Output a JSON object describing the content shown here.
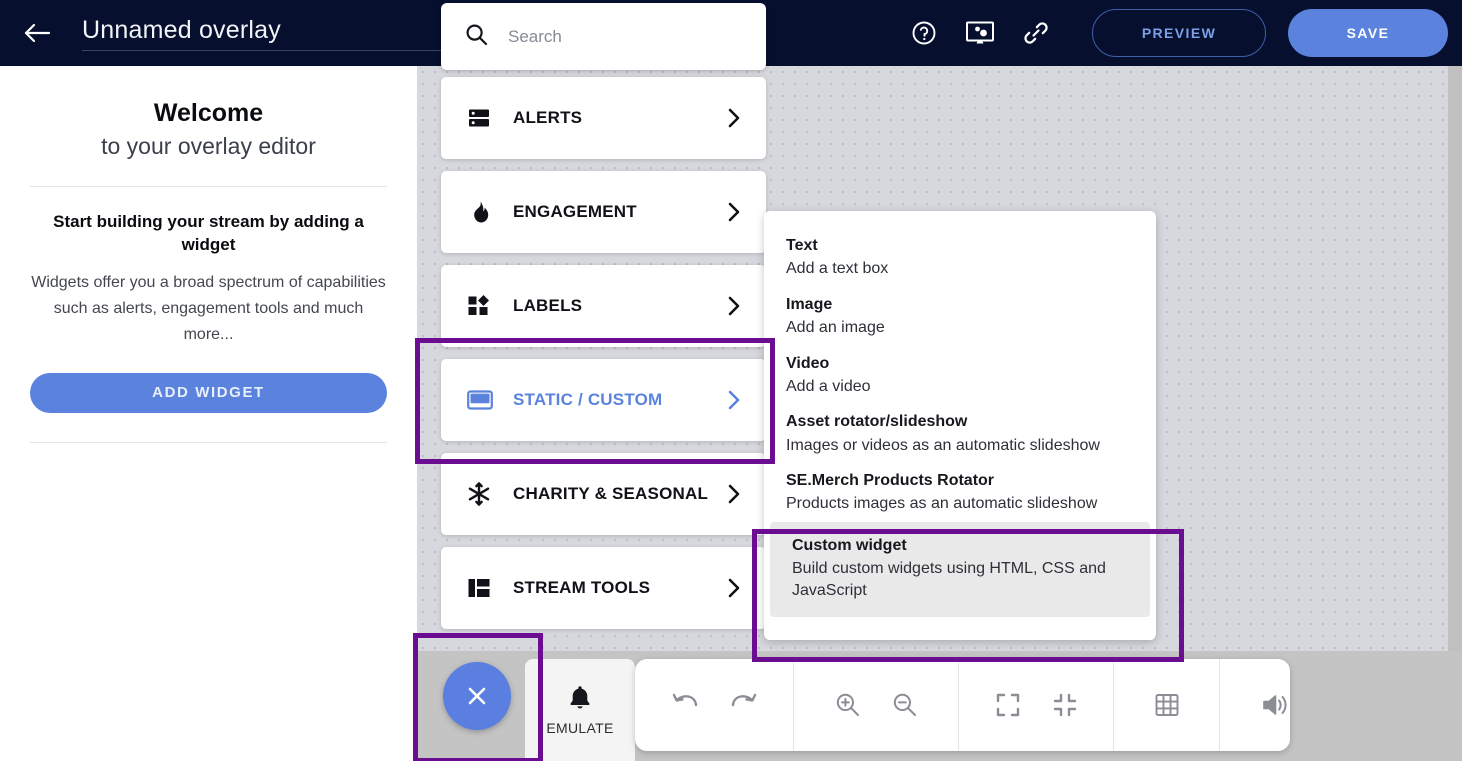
{
  "header": {
    "back_icon": "back-arrow-icon",
    "title": "Unnamed overlay",
    "icons": [
      {
        "name": "help-icon",
        "label": "?"
      },
      {
        "name": "monitor-settings-icon",
        "label": ""
      },
      {
        "name": "link-icon",
        "label": ""
      }
    ],
    "preview_label": "PREVIEW",
    "save_label": "SAVE",
    "bg_color": "#060f2e",
    "accent_color": "#5b83dd"
  },
  "left_panel": {
    "welcome_line1": "Welcome",
    "welcome_line2": "to your overlay editor",
    "start_heading": "Start building your stream by adding a widget",
    "start_body": "Widgets offer you a broad spectrum of capabilities such as alerts, engagement tools and much more...",
    "add_widget_label": "ADD WIDGET"
  },
  "search": {
    "placeholder": "Search",
    "value": "",
    "icon": "search-icon"
  },
  "widget_menu": {
    "items": [
      {
        "label": "ALERTS",
        "icon": "server-icon",
        "active": false
      },
      {
        "label": "ENGAGEMENT",
        "icon": "flame-icon",
        "active": false
      },
      {
        "label": "LABELS",
        "icon": "shapes-icon",
        "active": false
      },
      {
        "label": "STATIC / CUSTOM",
        "icon": "static-panel-icon",
        "active": true
      },
      {
        "label": "CHARITY & SEASONAL",
        "icon": "snowflake-icon",
        "active": false
      },
      {
        "label": "STREAM TOOLS",
        "icon": "layout-icon",
        "active": false
      }
    ]
  },
  "submenu": {
    "items": [
      {
        "title": "Text",
        "desc": "Add a text box",
        "highlighted": false
      },
      {
        "title": "Image",
        "desc": "Add an image",
        "highlighted": false
      },
      {
        "title": "Video",
        "desc": "Add a video",
        "highlighted": false
      },
      {
        "title": "Asset rotator/slideshow",
        "desc": "Images or videos as an automatic slideshow",
        "highlighted": false
      },
      {
        "title": "SE.Merch Products Rotator",
        "desc": "Products images as an automatic slideshow",
        "highlighted": false
      },
      {
        "title": "Custom widget",
        "desc": "Build custom widgets using HTML, CSS and JavaScript",
        "highlighted": true
      }
    ]
  },
  "bottom_bar": {
    "close_label": "×",
    "emulate_label": "EMULATE",
    "emulate_icon": "bell-icon",
    "tools": [
      {
        "name": "undo-button",
        "group": 1
      },
      {
        "name": "redo-button",
        "group": 1
      },
      {
        "name": "zoom-in-button",
        "group": 2
      },
      {
        "name": "zoom-out-button",
        "group": 2
      },
      {
        "name": "expand-button",
        "group": 3
      },
      {
        "name": "collapse-button",
        "group": 3
      },
      {
        "name": "grid-button",
        "group": 4
      },
      {
        "name": "volume-button",
        "group": 5
      }
    ]
  },
  "annotations": {
    "color": "#6a0d91",
    "boxes": [
      "static-custom-menu-item",
      "custom-widget-option",
      "close-widget-panel-button"
    ]
  }
}
